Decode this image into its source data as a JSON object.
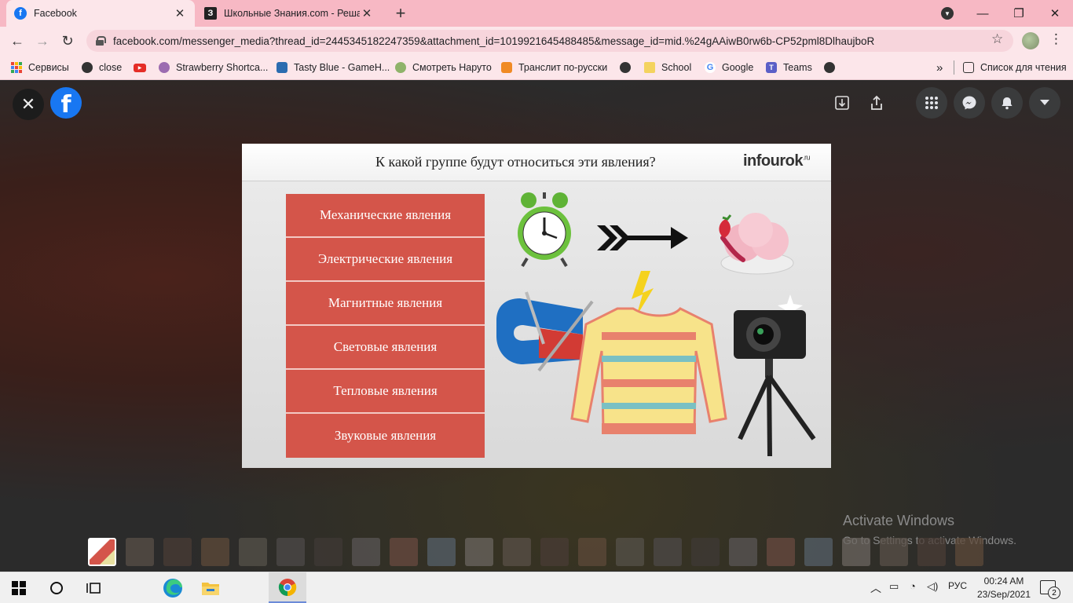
{
  "browser": {
    "tabs": [
      {
        "title": "Facebook",
        "icon": "facebook-icon",
        "active": true
      },
      {
        "title": "Школьные Знания.com - Решае",
        "icon": "znanija-icon",
        "active": false
      }
    ],
    "favicon_letters": {
      "facebook": "f",
      "znanija": "З"
    },
    "url": "facebook.com/messenger_media?thread_id=2445345182247359&attachment_id=1019921645488485&message_id=mid.%24gAAiwB0rw6b-CP52pml8DlhaujboR",
    "colors": {
      "tabstrip": "#f7b8c4",
      "toolbar": "#fce6ea",
      "facebook_blue": "#1877f2"
    }
  },
  "bookmarks": {
    "items": [
      {
        "label": "Сервисы",
        "icon": "apps-grid-icon"
      },
      {
        "label": "close",
        "icon": "globe-icon"
      },
      {
        "label": "",
        "icon": "youtube-icon"
      },
      {
        "label": "Strawberry Shortca...",
        "icon": "site-icon"
      },
      {
        "label": "Tasty Blue - GameH...",
        "icon": "game-icon"
      },
      {
        "label": "Смотреть Наруто",
        "icon": "naruto-icon"
      },
      {
        "label": "Транслит по-русски",
        "icon": "translit-icon"
      },
      {
        "label": "",
        "icon": "globe-icon"
      },
      {
        "label": "School",
        "icon": "folder-icon"
      },
      {
        "label": "Google",
        "icon": "google-icon"
      },
      {
        "label": "Teams",
        "icon": "teams-icon"
      },
      {
        "label": "",
        "icon": "globe-icon"
      }
    ],
    "reading_list": "Список для чтения"
  },
  "slide": {
    "title": "К какой группе будут относиться эти явления?",
    "brand": "infourok",
    "brand_suffix": ".ru",
    "phenomena": [
      "Механические явления",
      "Электрические явления",
      "Магнитные явления",
      "Световые явления",
      "Тепловые явления",
      "Звуковые явления"
    ],
    "accent": "#d4554a"
  },
  "watermark": {
    "line1": "Activate Windows",
    "line2": "Go to Settings to activate Windows."
  },
  "thumbnail_count": 24,
  "taskbar": {
    "language": "РУС",
    "time": "00:24 AM",
    "date": "23/Sep/2021",
    "notifications": "2"
  }
}
